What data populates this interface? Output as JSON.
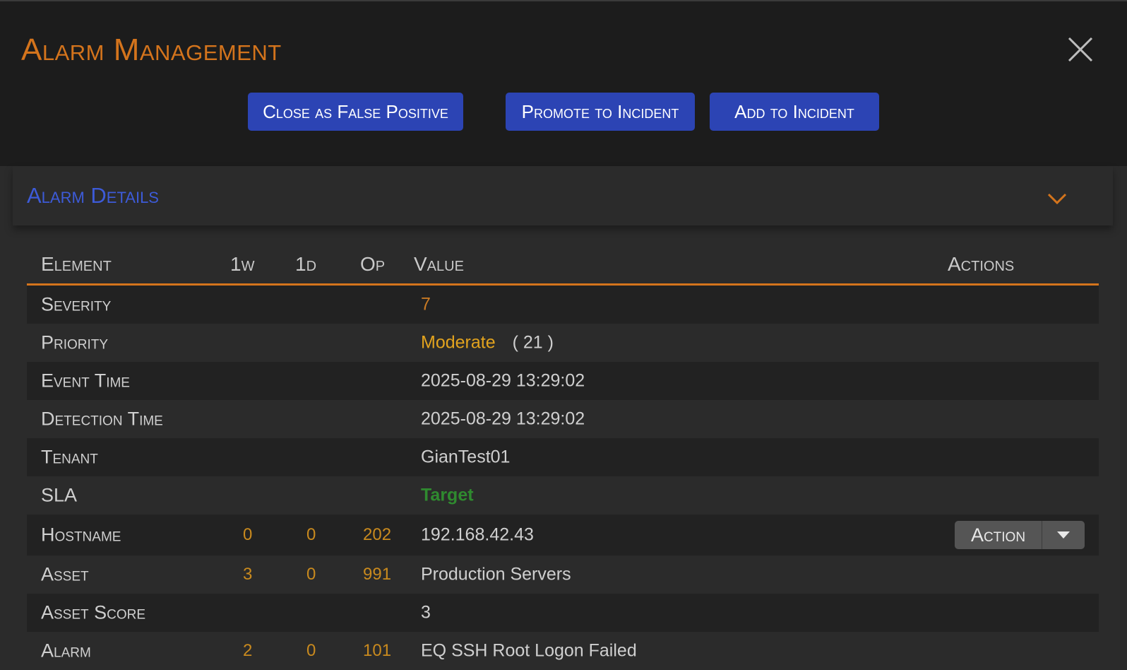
{
  "header": {
    "title": "Alarm Management",
    "buttons": {
      "close_false_positive": "Close as False Positive",
      "promote_incident": "Promote to Incident",
      "add_incident": "Add to Incident"
    }
  },
  "section": {
    "title": "Alarm Details"
  },
  "table": {
    "headers": {
      "element": "Element",
      "w1": "1w",
      "d1": "1d",
      "op": "Op",
      "value": "Value",
      "actions": "Actions"
    },
    "rows": [
      {
        "label": "Severity",
        "w1": "",
        "d1": "",
        "op": "",
        "value": "7"
      },
      {
        "label": "Priority",
        "w1": "",
        "d1": "",
        "op": "",
        "value": "Moderate",
        "extra": "( 21 )"
      },
      {
        "label": "Event Time",
        "w1": "",
        "d1": "",
        "op": "",
        "value": "2025-08-29 13:29:02"
      },
      {
        "label": "Detection Time",
        "w1": "",
        "d1": "",
        "op": "",
        "value": "2025-08-29 13:29:02"
      },
      {
        "label": "Tenant",
        "w1": "",
        "d1": "",
        "op": "",
        "value": "GianTest01"
      },
      {
        "label": "SLA",
        "w1": "",
        "d1": "",
        "op": "",
        "value": "Target"
      },
      {
        "label": "Hostname",
        "w1": "0",
        "d1": "0",
        "op": "202",
        "value": "192.168.42.43",
        "action": "Action"
      },
      {
        "label": "Asset",
        "w1": "3",
        "d1": "0",
        "op": "991",
        "value": "Production Servers"
      },
      {
        "label": "Asset Score",
        "w1": "",
        "d1": "",
        "op": "",
        "value": "3"
      },
      {
        "label": "Alarm",
        "w1": "2",
        "d1": "0",
        "op": "101",
        "value": "EQ SSH Root Logon Failed"
      }
    ]
  },
  "colors": {
    "accent_orange": "#d4741c",
    "primary_blue": "#2c44b4",
    "section_blue": "#3d5bd8",
    "sla_green": "#2f8a2f",
    "priority_amber": "#e2a31e"
  },
  "icons": {
    "close": "close-icon",
    "chevron": "chevron-down-icon",
    "caret": "caret-down-icon"
  }
}
